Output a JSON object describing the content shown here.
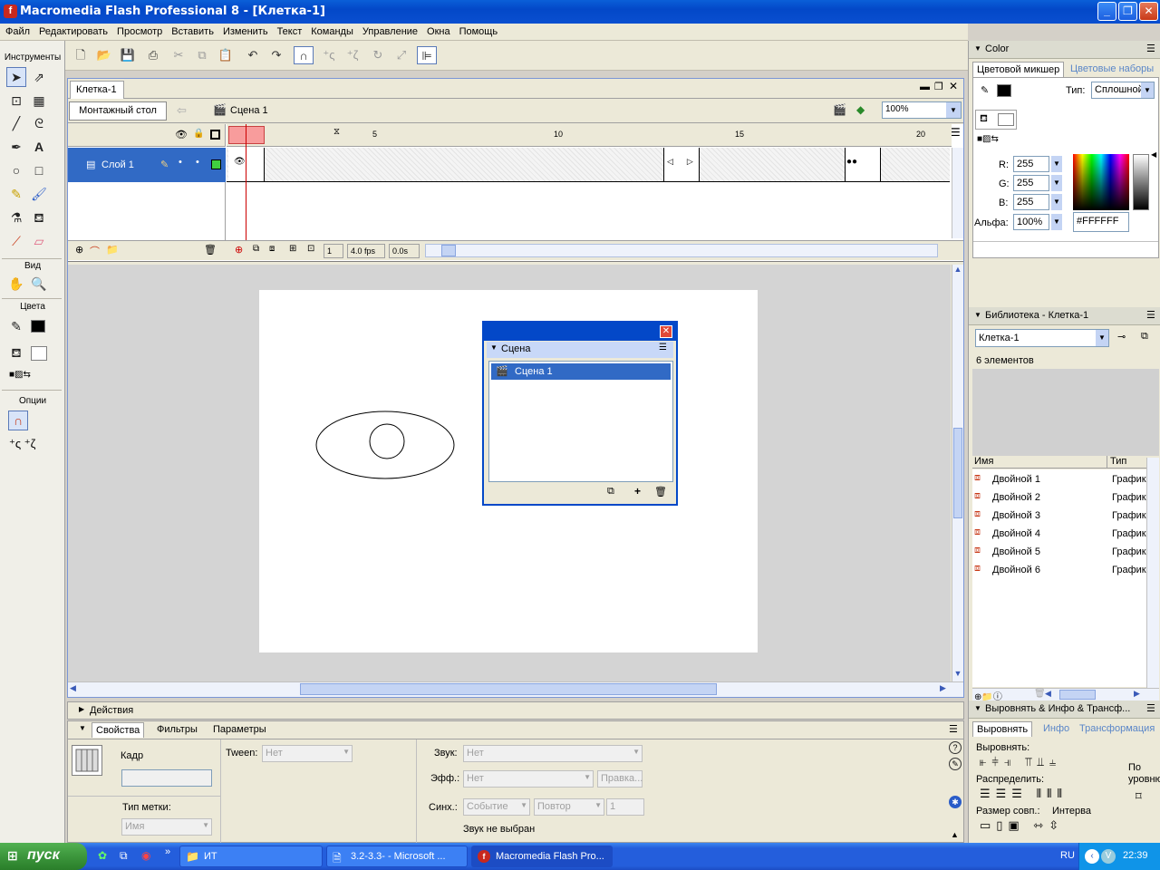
{
  "window": {
    "title": "Macromedia Flash Professional 8 - [Клетка-1]"
  },
  "menu": [
    "Файл",
    "Редактировать",
    "Просмотр",
    "Вставить",
    "Изменить",
    "Текст",
    "Команды",
    "Управление",
    "Окна",
    "Помощь"
  ],
  "tools": {
    "header": "Инструменты",
    "view_label": "Вид",
    "colors_label": "Цвета",
    "options_label": "Опции"
  },
  "document": {
    "tab": "Клетка-1",
    "stage_button": "Монтажный стол",
    "scene_crumb": "Сцена 1",
    "zoom": "100%"
  },
  "timeline": {
    "layer_name": "Слой 1",
    "ruler_marks": [
      "5",
      "10",
      "15",
      "20"
    ],
    "current_frame": "1",
    "fps": "4.0 fps",
    "time": "0.0s"
  },
  "scene_panel": {
    "title": "Сцена",
    "items": [
      "Сцена 1"
    ]
  },
  "actions": {
    "label": "Действия"
  },
  "properties": {
    "tabs": [
      "Свойства",
      "Фильтры",
      "Параметры"
    ],
    "frame_label": "Кадр",
    "label_type": "Тип метки:",
    "label_type_value": "Имя",
    "tween_label": "Tween:",
    "tween_value": "Нет",
    "sound_label": "Звук:",
    "sound_value": "Нет",
    "effect_label": "Эфф.:",
    "effect_value": "Нет",
    "edit_button": "Правка...",
    "sync_label": "Синх.:",
    "sync_value": "Событие",
    "repeat_value": "Повтор",
    "repeat_count": "1",
    "no_sound": "Звук не выбран"
  },
  "color_panel": {
    "title": "Color",
    "tab_mixer": "Цветовой микшер",
    "tab_swatches": "Цветовые наборы",
    "type_label": "Тип:",
    "type_value": "Сплошной",
    "r_label": "R:",
    "r_value": "255",
    "g_label": "G:",
    "g_value": "255",
    "b_label": "B:",
    "b_value": "255",
    "alpha_label": "Альфа:",
    "alpha_value": "100%",
    "hex_value": "#FFFFFF"
  },
  "library_panel": {
    "title": "Библиотека - Клетка-1",
    "selector": "Клетка-1",
    "count": "6 элементов",
    "col_name": "Имя",
    "col_type": "Тип",
    "items": [
      {
        "name": "Двойной 1",
        "type": "График"
      },
      {
        "name": "Двойной 2",
        "type": "График"
      },
      {
        "name": "Двойной 3",
        "type": "График"
      },
      {
        "name": "Двойной 4",
        "type": "График"
      },
      {
        "name": "Двойной 5",
        "type": "График"
      },
      {
        "name": "Двойной 6",
        "type": "График"
      }
    ]
  },
  "align_panel": {
    "title": "Выровнять & Инфо & Трансф...",
    "tabs": [
      "Выровнять",
      "Инфо",
      "Трансформация"
    ],
    "align_label": "Выровнять:",
    "distribute_label": "Распределить:",
    "match_size_label": "Размер совп.:",
    "space_label": "Интерва",
    "to_stage_label": "По уровню"
  },
  "taskbar": {
    "start": "пуск",
    "items": [
      "ИТ",
      "3.2-3.3- - Microsoft ...",
      "Macromedia Flash Pro..."
    ],
    "lang": "RU",
    "clock": "22:39"
  }
}
